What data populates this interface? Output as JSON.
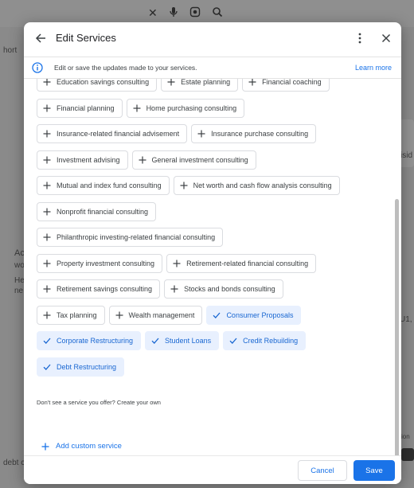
{
  "dialog": {
    "title": "Edit Services",
    "info_text": "Edit or save the updates made to your services.",
    "learn_more": "Learn more",
    "helper_text": "Don't see a service you offer? Create your own",
    "add_custom": "Add custom service",
    "cancel_label": "Cancel",
    "save_label": "Save"
  },
  "services": [
    [
      {
        "label": "Education savings consulting",
        "selected": false
      },
      {
        "label": "Estate planning",
        "selected": false
      },
      {
        "label": "Financial coaching",
        "selected": false
      }
    ],
    [
      {
        "label": "Financial planning",
        "selected": false
      },
      {
        "label": "Home purchasing consulting",
        "selected": false
      }
    ],
    [
      {
        "label": "Insurance-related financial advisement",
        "selected": false
      },
      {
        "label": "Insurance purchase consulting",
        "selected": false
      }
    ],
    [
      {
        "label": "Investment advising",
        "selected": false
      },
      {
        "label": "General investment consulting",
        "selected": false
      }
    ],
    [
      {
        "label": "Mutual and index fund consulting",
        "selected": false
      },
      {
        "label": "Net worth and cash flow analysis consulting",
        "selected": false
      }
    ],
    [
      {
        "label": "Nonprofit financial consulting",
        "selected": false
      }
    ],
    [
      {
        "label": "Philanthropic investing-related financial consulting",
        "selected": false
      }
    ],
    [
      {
        "label": "Property investment consulting",
        "selected": false
      },
      {
        "label": "Retirement-related financial consulting",
        "selected": false
      }
    ],
    [
      {
        "label": "Retirement savings consulting",
        "selected": false
      },
      {
        "label": "Stocks and bonds consulting",
        "selected": false
      }
    ],
    [
      {
        "label": "Tax planning",
        "selected": false
      },
      {
        "label": "Wealth management",
        "selected": false
      },
      {
        "label": "Consumer Proposals",
        "selected": true
      }
    ],
    [
      {
        "label": "Corporate Restructuring",
        "selected": true
      },
      {
        "label": "Student Loans",
        "selected": true
      },
      {
        "label": "Credit Rebuilding",
        "selected": true
      }
    ],
    [
      {
        "label": "Debt Restructuring",
        "selected": true
      }
    ]
  ],
  "background": {
    "left_text_1": "hort",
    "left_text_2": "Ac",
    "left_text_3": "wo",
    "left_text_4": "He",
    "left_text_5": "ne",
    "left_text_6": "debt c",
    "right_text_1": "isid",
    "right_text_2": "U1,",
    "right_text_3": "ion"
  },
  "colors": {
    "accent": "#1a73e8",
    "selected_bg": "#e8f0fe",
    "selected_text": "#1967d2"
  }
}
